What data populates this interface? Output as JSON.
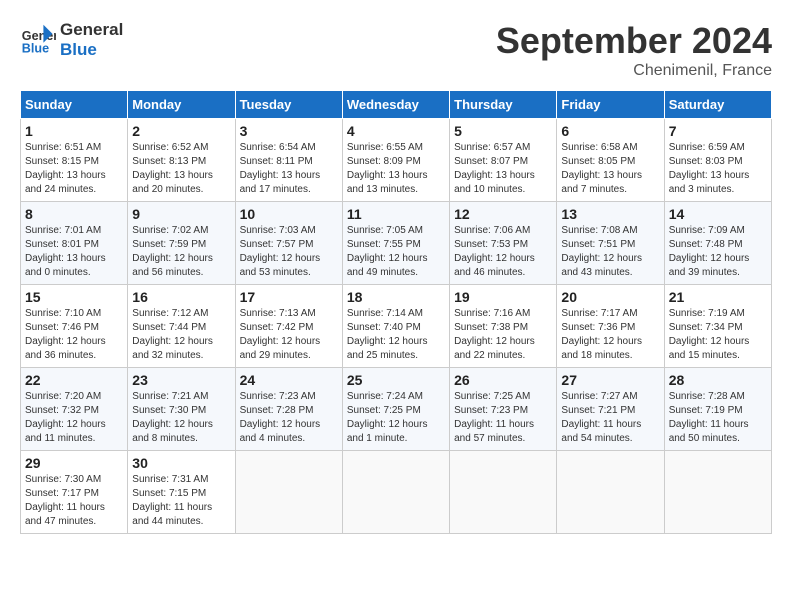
{
  "header": {
    "logo_line1": "General",
    "logo_line2": "Blue",
    "month_title": "September 2024",
    "location": "Chenimenil, France"
  },
  "columns": [
    "Sunday",
    "Monday",
    "Tuesday",
    "Wednesday",
    "Thursday",
    "Friday",
    "Saturday"
  ],
  "weeks": [
    [
      {
        "day": "1",
        "info": "Sunrise: 6:51 AM\nSunset: 8:15 PM\nDaylight: 13 hours\nand 24 minutes."
      },
      {
        "day": "2",
        "info": "Sunrise: 6:52 AM\nSunset: 8:13 PM\nDaylight: 13 hours\nand 20 minutes."
      },
      {
        "day": "3",
        "info": "Sunrise: 6:54 AM\nSunset: 8:11 PM\nDaylight: 13 hours\nand 17 minutes."
      },
      {
        "day": "4",
        "info": "Sunrise: 6:55 AM\nSunset: 8:09 PM\nDaylight: 13 hours\nand 13 minutes."
      },
      {
        "day": "5",
        "info": "Sunrise: 6:57 AM\nSunset: 8:07 PM\nDaylight: 13 hours\nand 10 minutes."
      },
      {
        "day": "6",
        "info": "Sunrise: 6:58 AM\nSunset: 8:05 PM\nDaylight: 13 hours\nand 7 minutes."
      },
      {
        "day": "7",
        "info": "Sunrise: 6:59 AM\nSunset: 8:03 PM\nDaylight: 13 hours\nand 3 minutes."
      }
    ],
    [
      {
        "day": "8",
        "info": "Sunrise: 7:01 AM\nSunset: 8:01 PM\nDaylight: 13 hours\nand 0 minutes."
      },
      {
        "day": "9",
        "info": "Sunrise: 7:02 AM\nSunset: 7:59 PM\nDaylight: 12 hours\nand 56 minutes."
      },
      {
        "day": "10",
        "info": "Sunrise: 7:03 AM\nSunset: 7:57 PM\nDaylight: 12 hours\nand 53 minutes."
      },
      {
        "day": "11",
        "info": "Sunrise: 7:05 AM\nSunset: 7:55 PM\nDaylight: 12 hours\nand 49 minutes."
      },
      {
        "day": "12",
        "info": "Sunrise: 7:06 AM\nSunset: 7:53 PM\nDaylight: 12 hours\nand 46 minutes."
      },
      {
        "day": "13",
        "info": "Sunrise: 7:08 AM\nSunset: 7:51 PM\nDaylight: 12 hours\nand 43 minutes."
      },
      {
        "day": "14",
        "info": "Sunrise: 7:09 AM\nSunset: 7:48 PM\nDaylight: 12 hours\nand 39 minutes."
      }
    ],
    [
      {
        "day": "15",
        "info": "Sunrise: 7:10 AM\nSunset: 7:46 PM\nDaylight: 12 hours\nand 36 minutes."
      },
      {
        "day": "16",
        "info": "Sunrise: 7:12 AM\nSunset: 7:44 PM\nDaylight: 12 hours\nand 32 minutes."
      },
      {
        "day": "17",
        "info": "Sunrise: 7:13 AM\nSunset: 7:42 PM\nDaylight: 12 hours\nand 29 minutes."
      },
      {
        "day": "18",
        "info": "Sunrise: 7:14 AM\nSunset: 7:40 PM\nDaylight: 12 hours\nand 25 minutes."
      },
      {
        "day": "19",
        "info": "Sunrise: 7:16 AM\nSunset: 7:38 PM\nDaylight: 12 hours\nand 22 minutes."
      },
      {
        "day": "20",
        "info": "Sunrise: 7:17 AM\nSunset: 7:36 PM\nDaylight: 12 hours\nand 18 minutes."
      },
      {
        "day": "21",
        "info": "Sunrise: 7:19 AM\nSunset: 7:34 PM\nDaylight: 12 hours\nand 15 minutes."
      }
    ],
    [
      {
        "day": "22",
        "info": "Sunrise: 7:20 AM\nSunset: 7:32 PM\nDaylight: 12 hours\nand 11 minutes."
      },
      {
        "day": "23",
        "info": "Sunrise: 7:21 AM\nSunset: 7:30 PM\nDaylight: 12 hours\nand 8 minutes."
      },
      {
        "day": "24",
        "info": "Sunrise: 7:23 AM\nSunset: 7:28 PM\nDaylight: 12 hours\nand 4 minutes."
      },
      {
        "day": "25",
        "info": "Sunrise: 7:24 AM\nSunset: 7:25 PM\nDaylight: 12 hours\nand 1 minute."
      },
      {
        "day": "26",
        "info": "Sunrise: 7:25 AM\nSunset: 7:23 PM\nDaylight: 11 hours\nand 57 minutes."
      },
      {
        "day": "27",
        "info": "Sunrise: 7:27 AM\nSunset: 7:21 PM\nDaylight: 11 hours\nand 54 minutes."
      },
      {
        "day": "28",
        "info": "Sunrise: 7:28 AM\nSunset: 7:19 PM\nDaylight: 11 hours\nand 50 minutes."
      }
    ],
    [
      {
        "day": "29",
        "info": "Sunrise: 7:30 AM\nSunset: 7:17 PM\nDaylight: 11 hours\nand 47 minutes."
      },
      {
        "day": "30",
        "info": "Sunrise: 7:31 AM\nSunset: 7:15 PM\nDaylight: 11 hours\nand 44 minutes."
      },
      {
        "day": "",
        "info": ""
      },
      {
        "day": "",
        "info": ""
      },
      {
        "day": "",
        "info": ""
      },
      {
        "day": "",
        "info": ""
      },
      {
        "day": "",
        "info": ""
      }
    ]
  ]
}
